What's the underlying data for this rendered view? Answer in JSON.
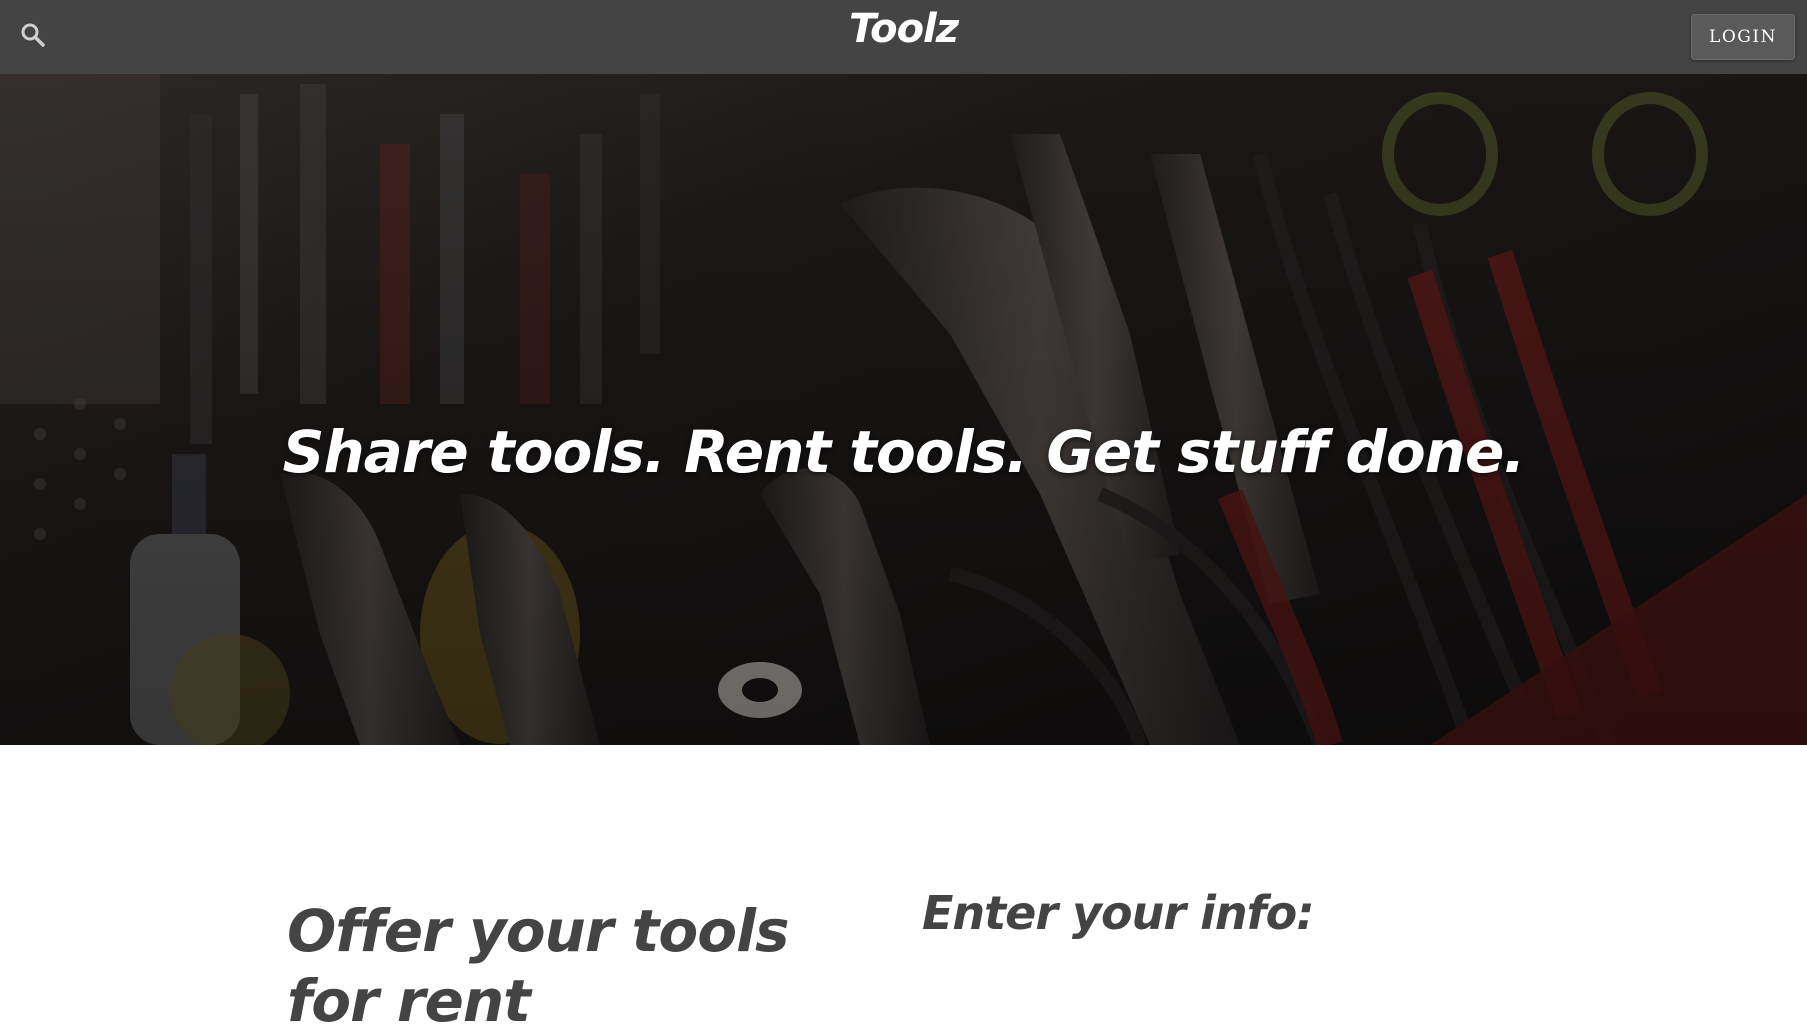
{
  "navbar": {
    "brand": "Toolz",
    "search_icon": "search-icon",
    "login_label": "LOGIN",
    "background": "#444444"
  },
  "hero": {
    "headline": "Share tools. Rent tools. Get stuff done.",
    "image": "workshop tools photo (pliers, wrenches)"
  },
  "content": {
    "left_heading": "Offer your tools for rent",
    "right_heading": "Enter your info:"
  },
  "colors": {
    "text_dark": "#444444",
    "white": "#ffffff"
  }
}
